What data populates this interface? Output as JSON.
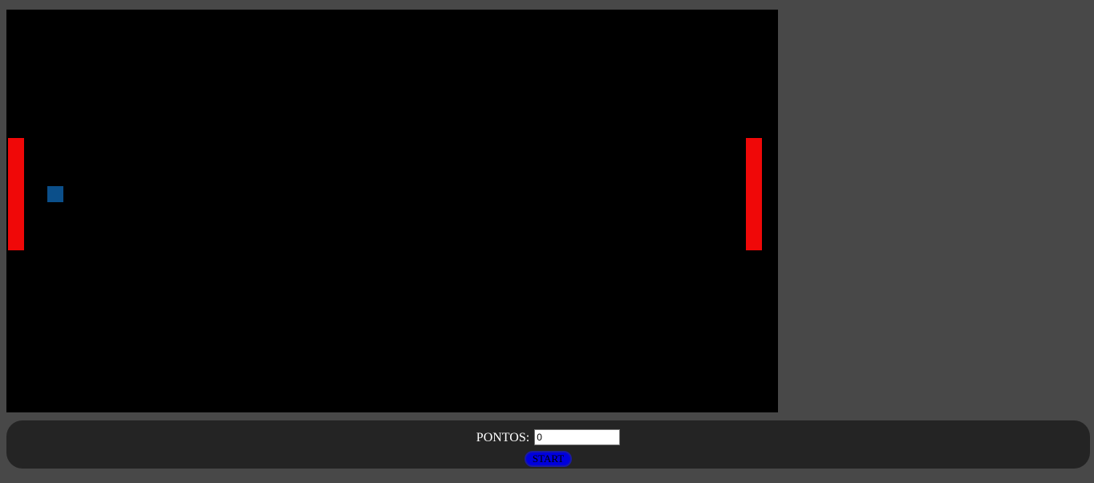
{
  "game": {
    "background_color": "#000000",
    "paddle_color": "#f00808",
    "ball_color": "#0b4f8a"
  },
  "controls": {
    "score_label": "PONTOS:",
    "score_value": "0",
    "start_label": "START"
  }
}
